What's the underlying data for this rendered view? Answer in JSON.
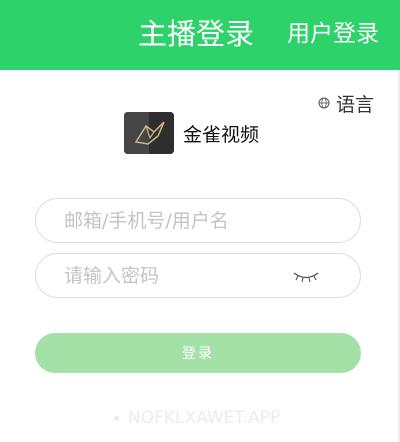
{
  "header": {
    "tab_streamer_login": "主播登录",
    "tab_user_login": "用户登录",
    "background_color": "#2dd26b"
  },
  "language": {
    "icon": "globe-icon",
    "label": "语言"
  },
  "brand": {
    "logo_icon": "bird-logo",
    "name": "金雀视频"
  },
  "form": {
    "account_placeholder": "邮箱/手机号/用户名",
    "password_placeholder": "请输入密码",
    "password_toggle_icon": "eye-closed-icon",
    "submit_label": "登录",
    "submit_color": "#a3e1a7"
  },
  "footer": {
    "domain": "NOFKLXAWET.APP"
  }
}
